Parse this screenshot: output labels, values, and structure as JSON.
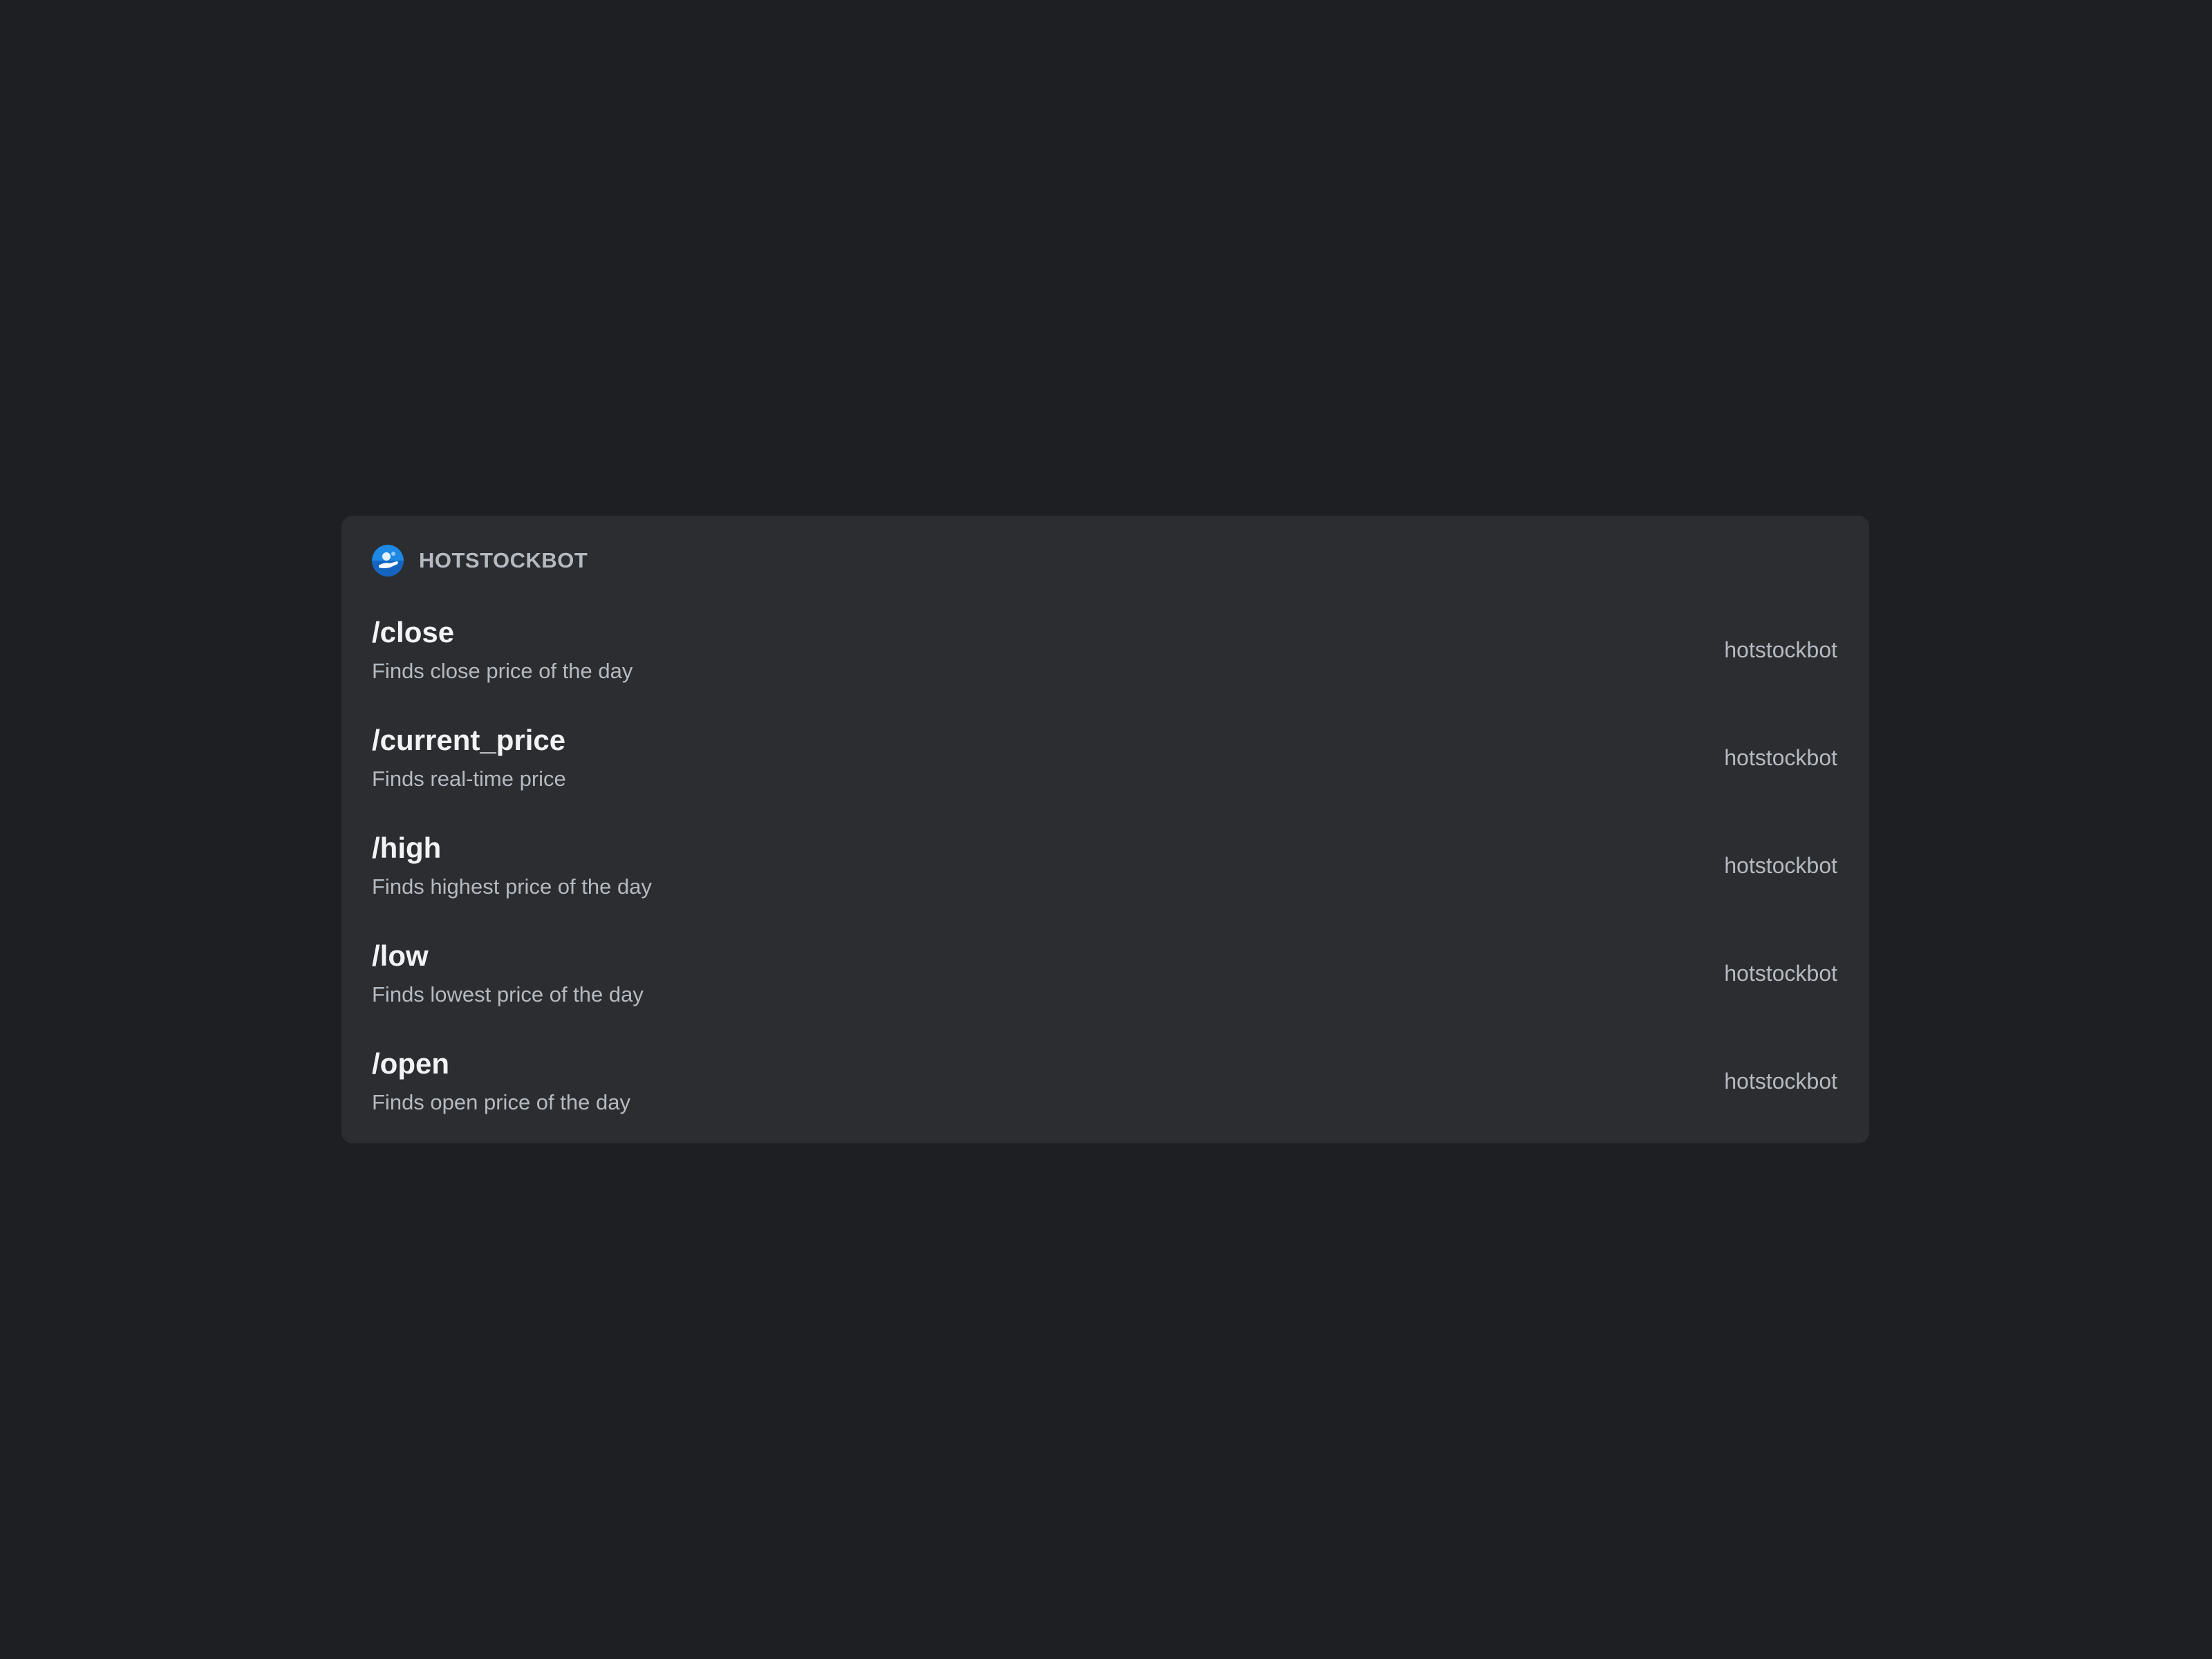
{
  "popup": {
    "bot_name": "HOTSTOCKBOT",
    "avatar_icon": "bot-avatar-icon",
    "commands": [
      {
        "name": "/close",
        "description": "Finds close price of the day",
        "source": "hotstockbot"
      },
      {
        "name": "/current_price",
        "description": "Finds real-time price",
        "source": "hotstockbot"
      },
      {
        "name": "/high",
        "description": "Finds highest price of the day",
        "source": "hotstockbot"
      },
      {
        "name": "/low",
        "description": "Finds lowest price of the day",
        "source": "hotstockbot"
      },
      {
        "name": "/open",
        "description": "Finds open price of the day",
        "source": "hotstockbot"
      }
    ]
  },
  "colors": {
    "background": "#1e1f22",
    "popup": "#2b2d31",
    "command_name": "#f2f3f5",
    "muted_text": "#b5bac1",
    "avatar": "#1e88e5"
  }
}
